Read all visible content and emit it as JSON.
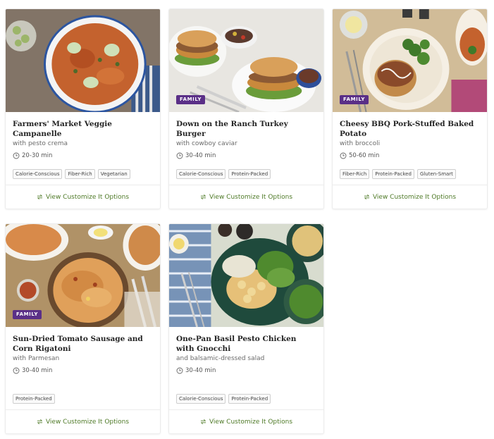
{
  "colors": {
    "badge": "#5a2f87",
    "link": "#4f7a28",
    "tag_border": "#cfcfcf"
  },
  "footer_label": "View Customize It Options",
  "badge_label": "FAMILY",
  "cards": [
    {
      "title": "Farmers' Market Veggie Campanelle",
      "subtitle": "with pesto crema",
      "time": "20-30 min",
      "tags": [
        "Calorie-Conscious",
        "Fiber-Rich",
        "Vegetarian"
      ],
      "family": false
    },
    {
      "title": "Down on the Ranch Turkey Burger",
      "subtitle": "with cowboy caviar",
      "time": "30-40 min",
      "tags": [
        "Calorie-Conscious",
        "Protein-Packed"
      ],
      "family": true
    },
    {
      "title": "Cheesy BBQ Pork-Stuffed Baked Potato",
      "subtitle": "with broccoli",
      "time": "50-60 min",
      "tags": [
        "Fiber-Rich",
        "Protein-Packed",
        "Gluten-Smart"
      ],
      "family": true
    },
    {
      "title": "Sun-Dried Tomato Sausage and Corn Rigatoni",
      "subtitle": "with Parmesan",
      "time": "30-40 min",
      "tags": [
        "Protein-Packed"
      ],
      "family": true
    },
    {
      "title": "One-Pan Basil Pesto Chicken with Gnocchi",
      "subtitle": "and balsamic-dressed salad",
      "time": "30-40 min",
      "tags": [
        "Calorie-Conscious",
        "Protein-Packed"
      ],
      "family": false
    }
  ]
}
